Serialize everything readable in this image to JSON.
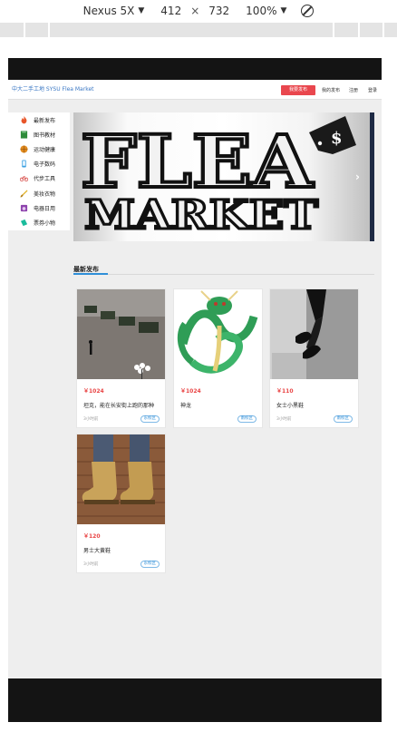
{
  "devtools": {
    "device": "Nexus 5X",
    "width": "412",
    "times": "×",
    "height": "732",
    "zoom": "100%"
  },
  "header": {
    "logo": "中大二手工地 SYSU Flea Market",
    "publish_label": "我要发布",
    "my_posts_label": "我的发布",
    "register_label": "注册",
    "login_label": "登录"
  },
  "sidebar": {
    "items": [
      {
        "label": "最新发布",
        "icon": "fire-icon",
        "color": "#e8562a"
      },
      {
        "label": "图书教材",
        "icon": "book-icon",
        "color": "#2e8b3a"
      },
      {
        "label": "运动健康",
        "icon": "ball-icon",
        "color": "#e08a1e"
      },
      {
        "label": "电子数码",
        "icon": "phone-icon",
        "color": "#3ba0e0"
      },
      {
        "label": "代步工具",
        "icon": "bike-icon",
        "color": "#d9534f"
      },
      {
        "label": "美妆衣物",
        "icon": "brush-icon",
        "color": "#e0b020"
      },
      {
        "label": "电器日用",
        "icon": "appliance-icon",
        "color": "#8e44ad"
      },
      {
        "label": "票券小物",
        "icon": "ticket-icon",
        "color": "#1abc9c"
      }
    ]
  },
  "banner": {
    "line1": "FLEA",
    "line2": "MARKET",
    "tag_symbol": "$",
    "next_arrow": "›"
  },
  "section": {
    "title": "最新发布"
  },
  "cards": [
    {
      "price": "￥1024",
      "title": "坦克，能在长安街上跑的那种",
      "time": "3小时前",
      "tag": "东校区",
      "image": "tank-photo"
    },
    {
      "price": "￥1024",
      "title": "神龙",
      "time": "",
      "tag": "南校区",
      "image": "dragon-image"
    },
    {
      "price": "￥110",
      "title": "女士小黑鞋",
      "time": "3小时前",
      "tag": "南校区",
      "image": "black-shoes-photo"
    },
    {
      "price": "￥120",
      "title": "男士大黄鞋",
      "time": "3小时前",
      "tag": "东校区",
      "image": "yellow-boots-photo"
    }
  ]
}
